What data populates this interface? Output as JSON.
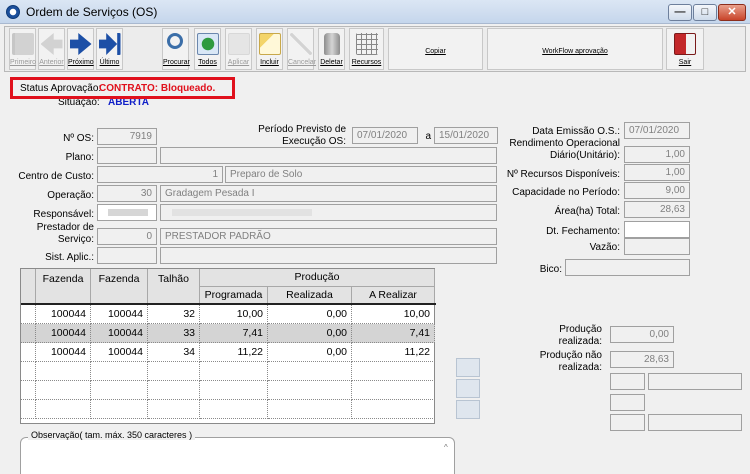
{
  "window": {
    "title": "Ordem de Serviços (OS)",
    "min_glyph": "—",
    "max_glyph": "□",
    "close_glyph": "✕"
  },
  "toolbar": {
    "first": "Primeiro",
    "previous": "Anterior",
    "next": "Próximo",
    "last": "Último",
    "search": "Procurar",
    "all": "Todos",
    "apply": "Aplicar",
    "include": "Incluir",
    "cancel": "Cancelar",
    "delete": "Deletar",
    "resources": "Recursos",
    "copy": "Copiar",
    "workflow": "WorkFlow aprovação",
    "exit": "Sair"
  },
  "status": {
    "label": "Status Aprovação:",
    "value": "CONTRATO: Bloqueado."
  },
  "situacao": {
    "label": "Situação:",
    "value": "ABERTA"
  },
  "form": {
    "os_label": "Nº OS:",
    "os_value": "7919",
    "periodo_label_1": "Período Previsto de",
    "periodo_label_2": "Execução OS:",
    "periodo_inicio": "07/01/2020",
    "periodo_sep": "a",
    "periodo_fim": "15/01/2020",
    "plano_label": "Plano:",
    "centro_label": "Centro de Custo:",
    "centro_code": "1",
    "centro_desc": "Preparo de Solo",
    "operacao_label": "Operação:",
    "operacao_code": "30",
    "operacao_desc": "Gradagem Pesada I",
    "responsavel_label": "Responsável:",
    "prestador_label_1": "Prestador de",
    "prestador_label_2": "Serviço:",
    "prestador_code": "0",
    "prestador_desc": "PRESTADOR PADRÃO",
    "sist_label": "Sist. Aplic.:"
  },
  "right_panel": {
    "emissao_label": "Data Emissão O.S.:",
    "emissao_value": "07/01/2020",
    "rendimento_label_1": "Rendimento Operacional",
    "rendimento_label_2": "Diário(Unitário):",
    "rendimento_value": "1,00",
    "recursos_label": "Nº Recursos Disponíveis:",
    "recursos_value": "1,00",
    "capacidade_label": "Capacidade no Período:",
    "capacidade_value": "9,00",
    "area_label": "Área(ha) Total:",
    "area_value": "28,63",
    "fechamento_label": "Dt. Fechamento:",
    "fechamento_value": "",
    "vazao_label": "Vazão:",
    "vazao_value": "",
    "bico_label": "Bico:",
    "bico_value": ""
  },
  "grid": {
    "headers": {
      "fazenda1": "Fazenda",
      "fazenda2": "Fazenda",
      "talhao": "Talhão",
      "producao": "Produção",
      "programada": "Programada",
      "realizada": "Realizada",
      "a_realizar": "A Realizar"
    },
    "rows": [
      {
        "fazenda1": "100044",
        "fazenda2": "100044",
        "talhao": "32",
        "programada": "10,00",
        "realizada": "0,00",
        "a_realizar": "10,00"
      },
      {
        "fazenda1": "100044",
        "fazenda2": "100044",
        "talhao": "33",
        "programada": "7,41",
        "realizada": "0,00",
        "a_realizar": "7,41"
      },
      {
        "fazenda1": "100044",
        "fazenda2": "100044",
        "talhao": "34",
        "programada": "11,22",
        "realizada": "0,00",
        "a_realizar": "11,22"
      }
    ]
  },
  "production": {
    "realizada_label_1": "Produção",
    "realizada_label_2": "realizada:",
    "realizada_value": "0,00",
    "nao_realizada_label_1": "Produção não",
    "nao_realizada_label_2": "realizada:",
    "nao_realizada_value": "28,63"
  },
  "observacao": {
    "label": "Observação( tam. máx. 350 caracteres )",
    "scroll_glyph": "^"
  },
  "colors": {
    "status_red": "#e0101c",
    "situacao_blue": "#1020c8"
  }
}
